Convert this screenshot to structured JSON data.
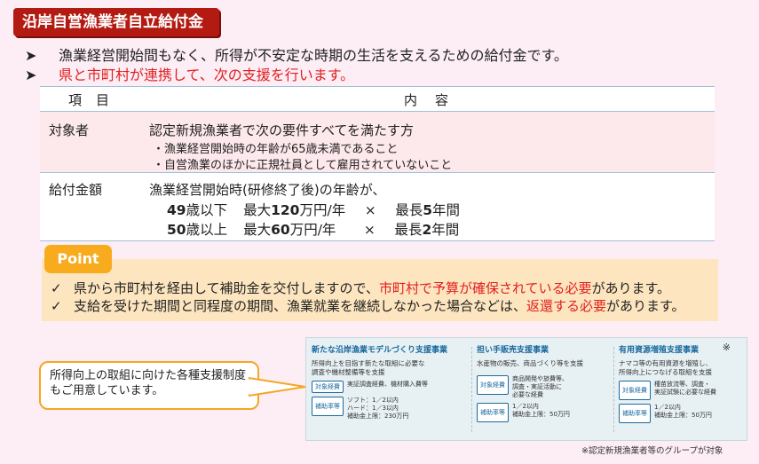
{
  "title": "沿岸自営漁業者自立給付金",
  "bullet_marker": "➤",
  "bullets": [
    "漁業経営開始間もなく、所得が不安定な時期の生活を支えるための給付金です。",
    "県と市町村が連携して、次の支援を行います。"
  ],
  "table": {
    "headers": [
      "項目",
      "内容"
    ],
    "row1": {
      "label": "対象者",
      "main": "認定新規漁業者で次の要件すべてを満たす方",
      "items": [
        "・漁業経営開始時の年齢が65歳未満であること",
        "・自営漁業のほかに正規社員として雇用されていないこと"
      ]
    },
    "row2": {
      "label": "給付金額",
      "main": "漁業経営開始時(研修終了後)の年齢が、",
      "lines": [
        {
          "age_num": "49",
          "age_suffix": "歳以下",
          "max_pre": "最大",
          "amount": "120",
          "unit": "万円/年",
          "times": "×",
          "period_pre": "最長",
          "years": "5",
          "period_suffix": "年間"
        },
        {
          "age_num": "50",
          "age_suffix": "歳以上",
          "max_pre": "最大",
          "amount": "60",
          "unit": "万円/年",
          "times": "×",
          "period_pre": "最長",
          "years": "2",
          "period_suffix": "年間"
        }
      ]
    }
  },
  "point": {
    "tab": "Point",
    "check": "✓",
    "line1": {
      "pre": "県から市町村を経由して補助金を交付しますので、",
      "red": "市町村で予算が確保されている必要",
      "post": "があります。"
    },
    "line2": {
      "pre": "支給を受けた期間と同程度の期間、漁業就業を継続しなかった場合などは、",
      "red": "返還する必要",
      "post": "があります。"
    }
  },
  "callout": {
    "line1": "所得向上の取組に向けた各種支援制度",
    "line2": "もご用意しています。"
  },
  "panel": {
    "cols": [
      {
        "heading": "新たな沿岸漁業モデルづくり支援事業",
        "desc1": "所得向上を目指す新たな取組に必要な",
        "desc2": "調査や機材整備等を支援",
        "tag1": "対象経費",
        "tag1_text": "実証調査経費、機材購入費等",
        "tag2": "補助率等",
        "tag2_l1": "ソフト：1／2以内",
        "tag2_l2": "ハード：1／3以内",
        "tag2_l3": "補助金上限：230万円"
      },
      {
        "heading": "担い手販売支援事業",
        "desc1": "水産物の販売、商品づくり等を支援",
        "desc2": "",
        "tag1": "対象経費",
        "tag1_l1": "商品開発や旅費等、",
        "tag1_l2": "調査・実証活動に",
        "tag1_l3": "必要な経費",
        "tag2": "補助率等",
        "tag2_l1": "1／2以内",
        "tag2_l2": "補助金上限：50万円"
      },
      {
        "heading": "有用資源増殖支援事業",
        "desc1": "ナマコ等の有用資源を増殖し、",
        "desc2": "所得向上につなげる取組を支援",
        "tag1": "対象経費",
        "tag1_l1": "種苗放流等、調査・",
        "tag1_l2": "実証試験に必要な経費",
        "tag2": "補助率等",
        "tag2_l1": "1／2以内",
        "tag2_l2": "補助金上限：50万円"
      }
    ],
    "star": "※"
  },
  "footnote": "※認定新規漁業者等のグループが対象"
}
